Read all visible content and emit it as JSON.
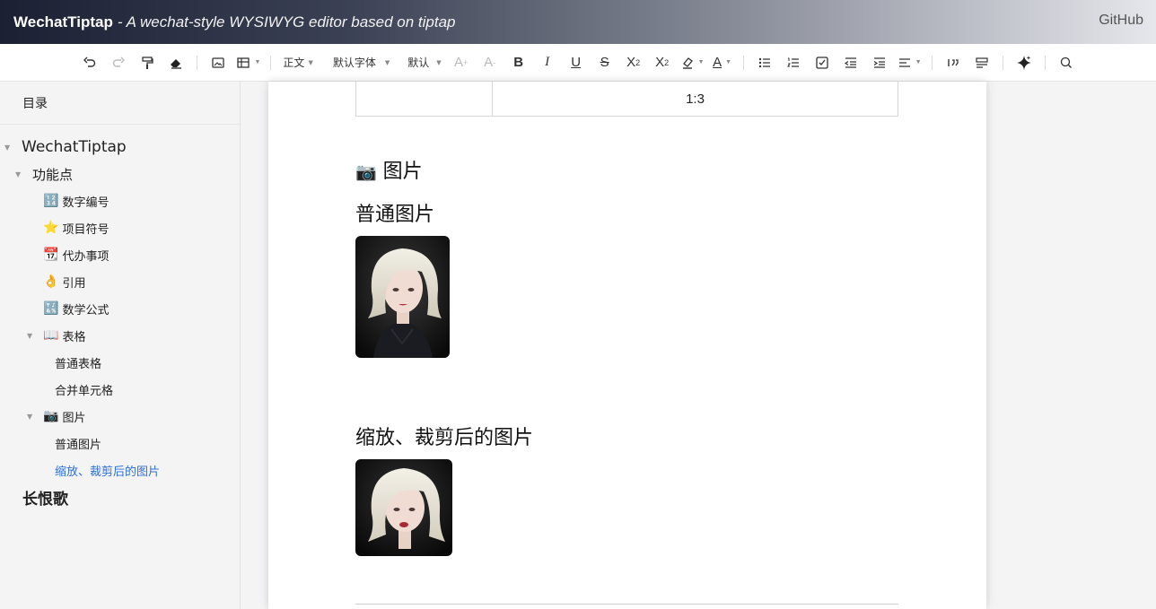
{
  "header": {
    "brand": "WechatTiptap",
    "tagline": "- A wechat-style WYSIWYG editor based on tiptap",
    "github": "GitHub"
  },
  "toolbar": {
    "style_select": "正文",
    "font_select": "默认字体",
    "size_select": "默认",
    "bold": "B",
    "italic": "I",
    "underline": "U",
    "strike": "S",
    "subscript": "X",
    "superscript": "X",
    "font_color": "A"
  },
  "sidebar": {
    "title": "目录",
    "items": [
      {
        "label": "WechatTiptap",
        "emoji": ""
      },
      {
        "label": "功能点",
        "emoji": ""
      },
      {
        "label": "数字编号",
        "emoji": "🔢"
      },
      {
        "label": "项目符号",
        "emoji": "⭐"
      },
      {
        "label": "代办事项",
        "emoji": "📆"
      },
      {
        "label": "引用",
        "emoji": "👌"
      },
      {
        "label": "数学公式",
        "emoji": "🔣"
      },
      {
        "label": "表格",
        "emoji": "📖"
      },
      {
        "label": "普通表格",
        "emoji": ""
      },
      {
        "label": "合并单元格",
        "emoji": ""
      },
      {
        "label": "图片",
        "emoji": "📷"
      },
      {
        "label": "普通图片",
        "emoji": ""
      },
      {
        "label": "缩放、裁剪后的图片",
        "emoji": ""
      },
      {
        "label": "长恨歌",
        "emoji": ""
      }
    ]
  },
  "doc": {
    "table_cell": "1:3",
    "section_emoji": "📷",
    "section_title": "图片",
    "sub1": "普通图片",
    "sub2": "缩放、裁剪后的图片"
  }
}
